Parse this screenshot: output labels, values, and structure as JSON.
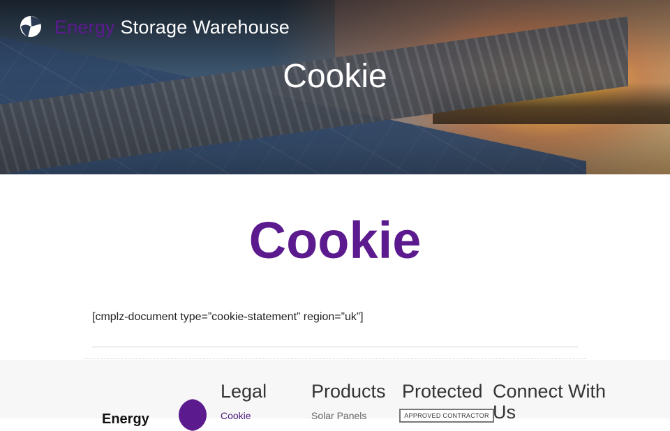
{
  "header": {
    "brand_accent": "Energy",
    "brand_rest": " Storage Warehouse",
    "hero_title": "Cookie"
  },
  "main": {
    "title": "Cookie",
    "shortcode": "[cmplz-document type=”cookie-statement” region=”uk”]"
  },
  "footer": {
    "brand_text": "Energy",
    "columns": {
      "legal": {
        "heading": "Legal",
        "links": [
          "Cookie"
        ]
      },
      "products": {
        "heading": "Products",
        "links": [
          "Solar Panels"
        ]
      },
      "protected": {
        "heading": "Protected",
        "badge": "APPROVED CONTRACTOR"
      },
      "connect": {
        "heading": "Connect With Us"
      }
    }
  },
  "colors": {
    "brand_purple": "#5c1a8f",
    "white": "#ffffff",
    "text_dark": "#222222",
    "footer_bg": "#f7f7f7"
  },
  "icons": {
    "logo": "brand-logo-icon"
  }
}
